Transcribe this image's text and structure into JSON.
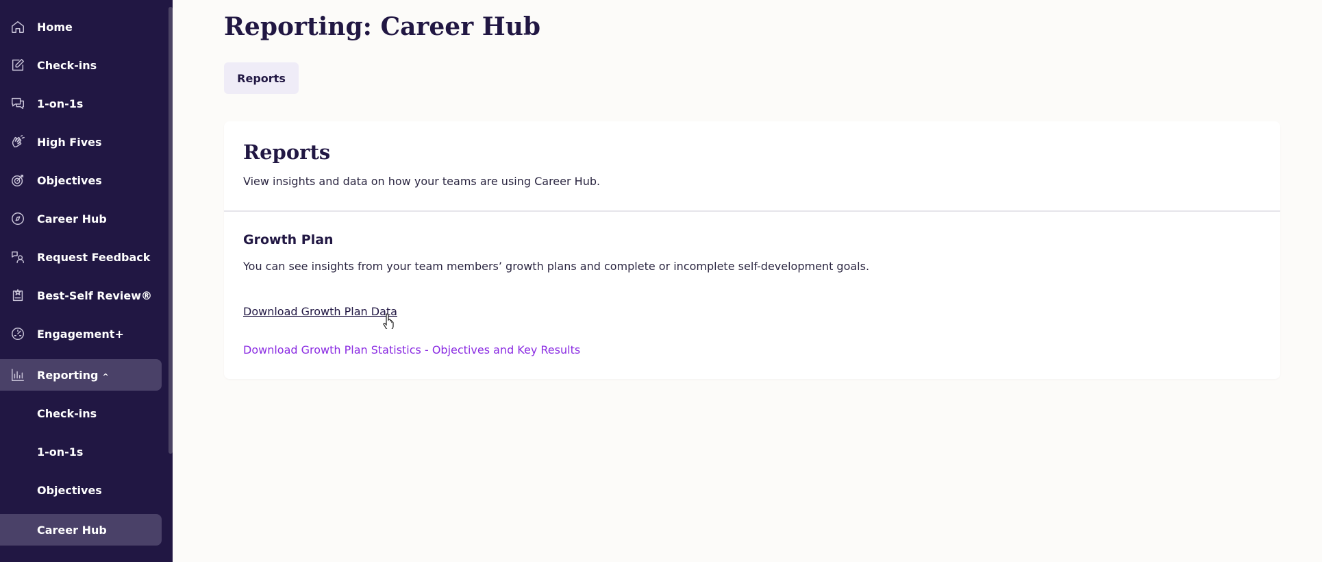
{
  "sidebar": {
    "items": [
      {
        "label": "Home",
        "icon": "home-icon"
      },
      {
        "label": "Check-ins",
        "icon": "edit-icon"
      },
      {
        "label": "1-on-1s",
        "icon": "chat-icon"
      },
      {
        "label": "High Fives",
        "icon": "high-five-icon"
      },
      {
        "label": "Objectives",
        "icon": "target-icon"
      },
      {
        "label": "Career Hub",
        "icon": "compass-icon"
      },
      {
        "label": "Request Feedback",
        "icon": "feedback-icon"
      },
      {
        "label": "Best-Self Review®",
        "icon": "review-icon"
      },
      {
        "label": "Engagement+",
        "icon": "gauge-icon"
      },
      {
        "label": "Reporting",
        "icon": "bar-chart-icon",
        "expanded": true
      }
    ],
    "sub_items": [
      {
        "label": "Check-ins"
      },
      {
        "label": "1-on-1s"
      },
      {
        "label": "Objectives"
      },
      {
        "label": "Career Hub",
        "active": true
      }
    ],
    "chevron": "^"
  },
  "main": {
    "title": "Reporting: Career Hub",
    "tab_label": "Reports",
    "card": {
      "title": "Reports",
      "subtitle": "View insights and data on how your teams are using Career Hub.",
      "section_title": "Growth Plan",
      "section_desc": "You can see insights from your team members’ growth plans and complete or incomplete self-development goals.",
      "link_primary": "Download Growth Plan Data",
      "link_secondary": "Download Growth Plan Statistics - Objectives and Key Results"
    }
  },
  "colors": {
    "sidebar_bg": "#211743",
    "active_bg": "#4a4168",
    "page_bg": "#fcfbf9",
    "link_purple": "#8a2be2",
    "tab_bg": "#efecf7"
  }
}
